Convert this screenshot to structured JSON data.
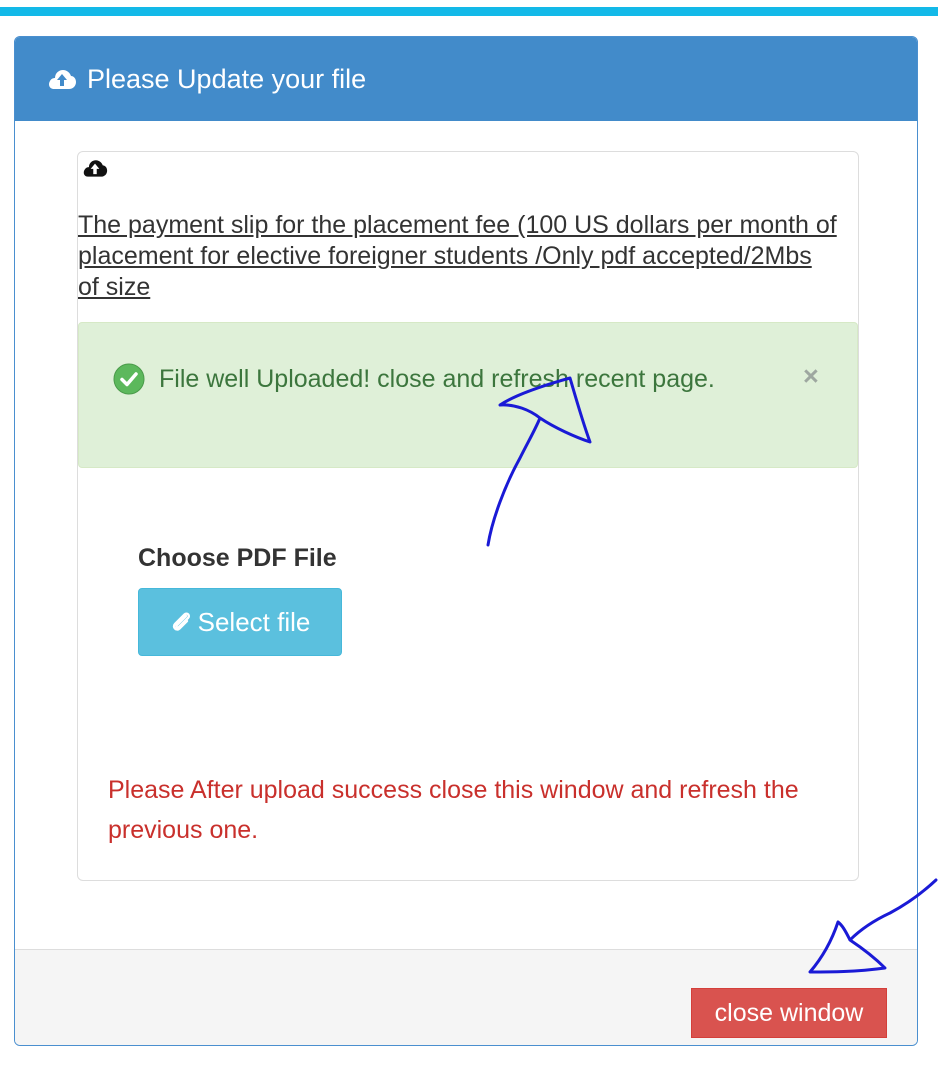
{
  "header": {
    "title": "Please Update your file",
    "icon": "cloud-upload-icon"
  },
  "upload_box": {
    "icon": "cloud-upload-icon",
    "description": "The payment slip for the placement fee (100 US dollars per month of placement for elective foreigner students /Only pdf accepted/2Mbs of size",
    "alert": {
      "message": "File well Uploaded! close and refresh recent page.",
      "close_label": "×",
      "icon": "check-circle-icon"
    },
    "choose_label": "Choose PDF File",
    "select_button_label": "Select file",
    "select_button_icon": "paperclip-icon",
    "warning": "Please After upload success close this window and refresh the previous one."
  },
  "footer": {
    "close_button_label": "close window"
  },
  "colors": {
    "accent_bar": "#13b9e8",
    "header_bg": "#428bca",
    "alert_bg": "#dff0d8",
    "alert_text": "#3c763d",
    "info_button": "#5bc0de",
    "danger_button": "#d9534f",
    "warning_text": "#c9302c",
    "annotation_ink": "#1a1ad6"
  }
}
